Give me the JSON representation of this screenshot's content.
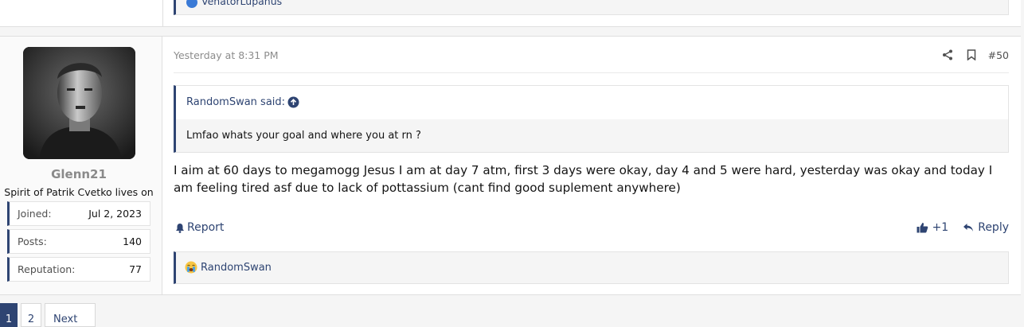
{
  "previous_post": {
    "reaction_user": "VenatorLupanus"
  },
  "post": {
    "author": {
      "name": "Glenn21",
      "title": "Spirit of Patrik Cvetko lives on",
      "stats": [
        {
          "label": "Joined:",
          "value": "Jul 2, 2023"
        },
        {
          "label": "Posts:",
          "value": "140"
        },
        {
          "label": "Reputation:",
          "value": "77"
        }
      ]
    },
    "timestamp": "Yesterday at 8:31 PM",
    "post_number": "#50",
    "quote": {
      "author_label": "RandomSwan said:",
      "text": "Lmfao whats your goal and where you at rn ?"
    },
    "message": "I aim at 60 days to megamogg Jesus I am at day 7 atm, first 3 days were okay, day 4 and 5 were hard, yesterday was okay and today I am feeling tired asf due to lack of pottassium (cant find good suplement anywhere)",
    "actions": {
      "report_label": "Report",
      "like_count": "+1",
      "reply_label": "Reply"
    },
    "reactions": {
      "emoji": "😭",
      "user": "RandomSwan"
    }
  },
  "pagination": {
    "current": "1",
    "page2": "2",
    "next_label": "Next"
  },
  "colors": {
    "accent": "#2e4472",
    "username_gray": "#8a8a8a"
  },
  "icons": [
    "share-icon",
    "bookmark-icon",
    "arrow-up-circle-icon",
    "bell-icon",
    "thumbs-up-icon",
    "reply-icon"
  ]
}
